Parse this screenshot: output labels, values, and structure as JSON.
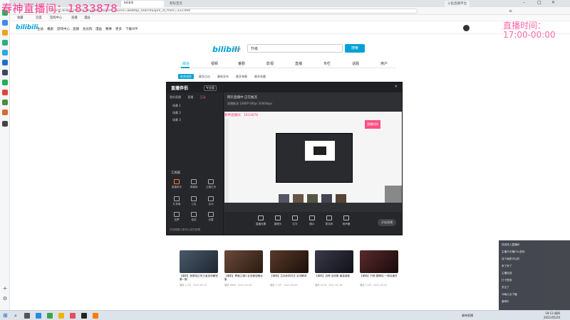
{
  "overlay": {
    "title": "春神直播间：1833878",
    "time_label": "直播时间：",
    "time_range": "17:00-00:00"
  },
  "browser": {
    "tabs": [
      "bilibili",
      "新标签页",
      "斗鱼直播平台"
    ],
    "url": "search.bilibili.com/all?keyword=&from_source=webtop_search&spm_id_from=333.999",
    "bookmarks": [
      "收藏",
      "百度",
      "游戏中心",
      "直播",
      "漫画",
      "赛事",
      "更多",
      "下载APP"
    ]
  },
  "bili": {
    "header_nav": [
      "主站",
      "番剧",
      "游戏中心",
      "直播",
      "会员购",
      "漫画",
      "赛事",
      "更多",
      "下载APP"
    ],
    "logo": "bilibili",
    "logo_sub": "搜索",
    "search_value": "升级",
    "search_button": "搜索",
    "categories": [
      "综合",
      "视频",
      "番剧",
      "影视",
      "直播",
      "专栏",
      "话题",
      "用户"
    ],
    "filters": [
      "综合排序",
      "最多点击",
      "最新发布",
      "最多弹幕",
      "最多收藏"
    ]
  },
  "obs": {
    "brand": "直播伴侣",
    "badge": "专业版",
    "subtabs": [
      "我的直播",
      "直播",
      "互动"
    ],
    "scenes": [
      "场景 1",
      "场景 2",
      "场景 3"
    ],
    "tools_title": "工具箱",
    "tools": [
      "直播助手",
      "弹幕姬",
      "主播日历",
      "礼物墙",
      "公告",
      "活动",
      "投票",
      "抽奖",
      "设置"
    ],
    "left_bottom": "在线观看人数可以实时查看",
    "title": "网页直播中·正在推流",
    "info": "直播推流  1080P  60fps  3000kbps",
    "preview_overlay": "春神直播间：1833878",
    "preview_badge": "直播时间",
    "bottom": [
      "直播设置",
      "摄像头",
      "文字",
      "图片",
      "麦克风",
      "扬声器"
    ],
    "live_button": "开始直播"
  },
  "videos": [
    {
      "title": "【单机】我是真正的王者游戏解说第一期",
      "meta": "播放 1.2万 · 2021-03-12"
    },
    {
      "title": "【单机】黑暗之魂3 全流程攻略合集",
      "meta": "播放 8650 · 2021-02-28"
    },
    {
      "title": "【单机】生化危机村庄 实况解说",
      "meta": "播放 2.3万 · 2021-05-09"
    },
    {
      "title": "【单机】战神 全收集 最高难度",
      "meta": "播放 5120 · 2021-01-16"
    },
    {
      "title": "【单机】只狼 剧情向 一周目通关",
      "meta": "播放 3.4万 · 2021-04-02"
    }
  ],
  "chat": [
    "欢迎进入直播间",
    "主播今天播什么游戏",
    "这个画质可以的",
    "来了来了",
    "主播加油",
    "打卡签到",
    "关注了",
    "今晚几点下播",
    "春神牛"
  ],
  "taskbar": {
    "time": "19:13 周四",
    "date": "2021/05/20",
    "tray": "春神直播"
  },
  "colors": {
    "bili_blue": "#00a1d6",
    "overlay_pink": "#ff3c8e"
  }
}
